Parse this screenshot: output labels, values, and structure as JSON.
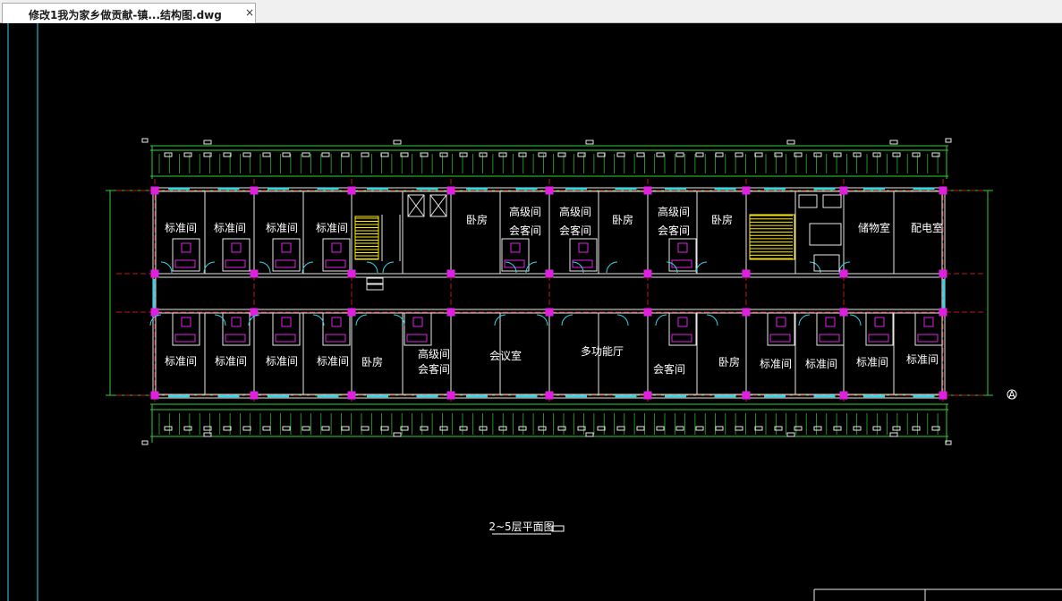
{
  "tab": {
    "title": "修改1我为家乡做贡献-镇...结构图.dwg",
    "close": "×"
  },
  "drawing": {
    "caption": "2~5层平面图",
    "axis_label": "A",
    "rooms_top": [
      {
        "id": "t1",
        "label": "标准间"
      },
      {
        "id": "t2",
        "label": "标准间"
      },
      {
        "id": "t3",
        "label": "标准间"
      },
      {
        "id": "t4",
        "label": "标准间"
      },
      {
        "id": "t5",
        "label": "卧房"
      },
      {
        "id": "t6a",
        "label": "高级间"
      },
      {
        "id": "t6b",
        "label": "会客间"
      },
      {
        "id": "t7a",
        "label": "高级间"
      },
      {
        "id": "t7b",
        "label": "会客间"
      },
      {
        "id": "t8",
        "label": "卧房"
      },
      {
        "id": "t9a",
        "label": "高级间"
      },
      {
        "id": "t9b",
        "label": "会客间"
      },
      {
        "id": "t10",
        "label": "卧房"
      },
      {
        "id": "t11",
        "label": "储物室"
      },
      {
        "id": "t12",
        "label": "配电室"
      }
    ],
    "rooms_bottom": [
      {
        "id": "b1",
        "label": "标准间"
      },
      {
        "id": "b2",
        "label": "标准间"
      },
      {
        "id": "b3",
        "label": "标准间"
      },
      {
        "id": "b4",
        "label": "标准间"
      },
      {
        "id": "b5",
        "label": "卧房"
      },
      {
        "id": "b6a",
        "label": "高级间"
      },
      {
        "id": "b6b",
        "label": "会客间"
      },
      {
        "id": "b7",
        "label": "会议室"
      },
      {
        "id": "b8",
        "label": "多功能厅"
      },
      {
        "id": "b9",
        "label": "会客间"
      },
      {
        "id": "b10",
        "label": "卧房"
      },
      {
        "id": "b11",
        "label": "标准间"
      },
      {
        "id": "b12",
        "label": "标准间"
      },
      {
        "id": "b13",
        "label": "标准间"
      },
      {
        "id": "b14",
        "label": "标准间"
      }
    ]
  }
}
